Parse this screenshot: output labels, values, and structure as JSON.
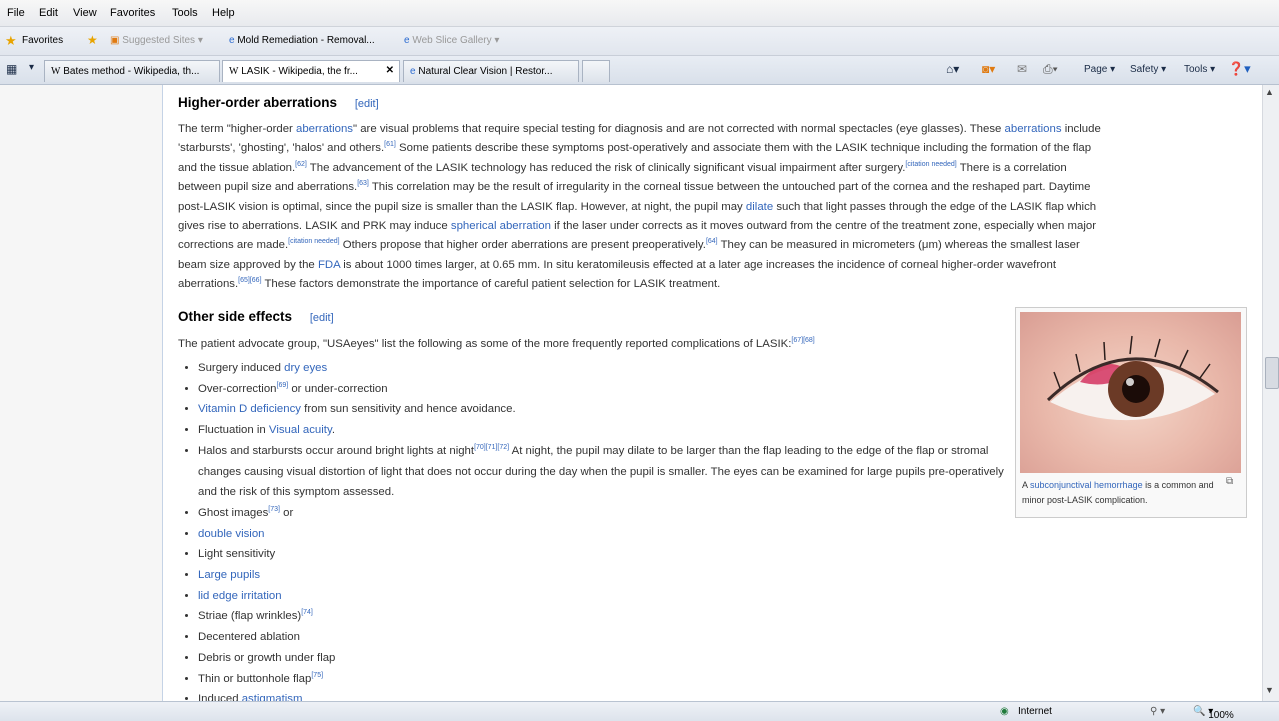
{
  "menu": [
    "File",
    "Edit",
    "View",
    "Favorites",
    "Tools",
    "Help"
  ],
  "favorites_bar": {
    "favorites_label": "Favorites",
    "suggested_sites": "Suggested Sites",
    "mold_link": "Mold Remediation - Removal...",
    "web_slice": "Web Slice Gallery"
  },
  "tabs": [
    {
      "label": "Bates method - Wikipedia, th..."
    },
    {
      "label": "LASIK - Wikipedia, the fr...",
      "close": "✕"
    },
    {
      "label": "Natural Clear Vision | Restor..."
    }
  ],
  "command_bar": {
    "page": "Page",
    "safety": "Safety",
    "tools": "Tools"
  },
  "section1": {
    "title": "Higher-order aberrations",
    "edit": "[edit]",
    "lines": [
      [
        "The term \"higher-order ",
        {
          "link": "aberrations"
        },
        "\" are visual problems that require special testing for diagnosis and are not corrected with normal spectacles (eye glasses). These ",
        {
          "link": "aberrations"
        },
        " include"
      ],
      [
        "'starbursts', 'ghosting', 'halos' and others.",
        {
          "ref": "[61]"
        },
        " Some patients describe these symptoms post-operatively and associate them with the LASIK technique including the formation of the flap"
      ],
      [
        "and the tissue ablation.",
        {
          "ref": "[62]"
        },
        " The advancement of the LASIK technology has reduced the risk of clinically significant visual impairment after surgery.",
        {
          "ref": "[citation needed]"
        },
        " There is a correlation"
      ],
      [
        "between pupil size and aberrations.",
        {
          "ref": "[63]"
        },
        " This correlation may be the result of irregularity in the corneal tissue between the untouched part of the cornea and the reshaped part. Daytime"
      ],
      [
        "post-LASIK vision is optimal, since the pupil size is smaller than the LASIK flap. However, at night, the pupil may ",
        {
          "link": "dilate"
        },
        " such that light passes through the edge of the LASIK flap which"
      ],
      [
        "gives rise to aberrations. LASIK and PRK may induce ",
        {
          "link": "spherical aberration"
        },
        " if the laser under corrects as it moves outward from the centre of the treatment zone, especially when major"
      ],
      [
        "corrections are made.",
        {
          "ref": "[citation needed]"
        },
        " Others propose that higher order aberrations are present preoperatively.",
        {
          "ref": "[64]"
        },
        " They can be measured in micrometers (μm) whereas the smallest laser"
      ],
      [
        "beam size approved by the ",
        {
          "link": "FDA"
        },
        " is about 1000 times larger, at 0.65 mm. In situ keratomileusis effected at a later age increases the incidence of corneal higher-order wavefront"
      ],
      [
        "aberrations.",
        {
          "ref": "[65][66]"
        },
        " These factors demonstrate the importance of careful patient selection for LASIK treatment."
      ]
    ]
  },
  "section2": {
    "title": "Other side effects",
    "edit": "[edit]",
    "intro": [
      "The patient advocate group, \"USAeyes\" list the following as some of the more frequently reported complications of LASIK:",
      {
        "ref": "[67][68]"
      }
    ],
    "items": [
      [
        "Surgery induced ",
        {
          "link": "dry eyes"
        }
      ],
      [
        "Over-correction",
        {
          "ref": "[69]"
        },
        " or under-correction"
      ],
      [
        {
          "link": "Vitamin D deficiency"
        },
        " from sun sensitivity and hence avoidance."
      ],
      [
        "Fluctuation in ",
        {
          "link": "Visual acuity"
        },
        "."
      ],
      [
        "Halos and starbursts occur around bright lights at night",
        {
          "ref": "[70][71][72]"
        },
        " At night, the pupil may dilate to be larger than the flap leading to the edge of the flap or stromal changes causing visual distortion of light that does not occur during the day when the pupil is smaller. The eyes can be examined for large pupils pre-operatively and the risk of this symptom assessed."
      ],
      [
        "Ghost images",
        {
          "ref": "[73]"
        },
        " or"
      ],
      [
        {
          "link": "double vision"
        }
      ],
      [
        "Light sensitivity"
      ],
      [
        {
          "link": "Large pupils"
        }
      ],
      [
        {
          "link": "lid edge irritation"
        }
      ],
      [
        "Striae (flap wrinkles)",
        {
          "ref": "[74]"
        }
      ],
      [
        "Decentered ablation"
      ],
      [
        "Debris or growth under flap"
      ],
      [
        "Thin or buttonhole flap",
        {
          "ref": "[75]"
        }
      ],
      [
        "Induced ",
        {
          "link": "astigmatism"
        }
      ]
    ]
  },
  "thumbnail": {
    "caption_pre": "A ",
    "caption_link": "subconjunctival hemorrhage",
    "caption_post": " is a common and minor post-LASIK complication."
  },
  "status": {
    "zone": "Internet",
    "zoom": "100%"
  },
  "colors": {
    "link": "#3366bb",
    "text": "#333333"
  }
}
